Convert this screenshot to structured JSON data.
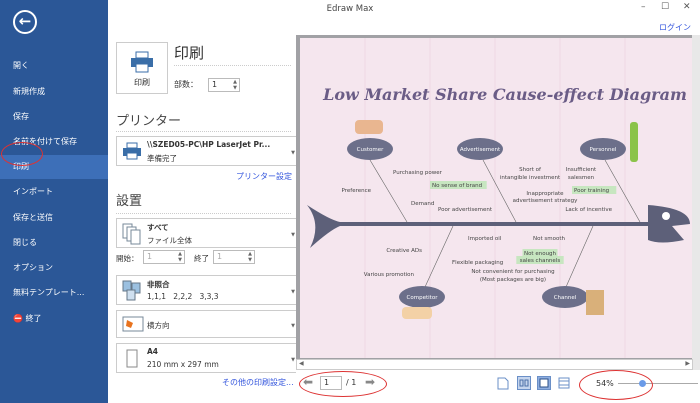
{
  "window": {
    "title": "Edraw Max",
    "login": "ログイン"
  },
  "sidebar": {
    "items": [
      {
        "label": "開く"
      },
      {
        "label": "新規作成"
      },
      {
        "label": "保存"
      },
      {
        "label": "名前を付けて保存"
      },
      {
        "label": "印刷"
      },
      {
        "label": "インポート"
      },
      {
        "label": "保存と送信"
      },
      {
        "label": "閉じる"
      },
      {
        "label": "オプション"
      },
      {
        "label": "無料テンプレート..."
      },
      {
        "label": "終了"
      }
    ],
    "active": "印刷"
  },
  "print": {
    "heading": "印刷",
    "button_label": "印刷",
    "copies_label": "部数：",
    "copies_value": "1"
  },
  "printer": {
    "heading": "プリンター",
    "name": "\\\\SZED05-PC\\HP LaserJet Pr...",
    "status": "準備完了",
    "settings_link": "プリンター設定"
  },
  "settings": {
    "heading": "設置",
    "range_title": "すべて",
    "range_sub": "ファイル全体",
    "start_label": "開始：",
    "start_value": "1",
    "end_label": "終了",
    "end_value": "1",
    "collate_title": "非照合",
    "collate_sub": "1,1,1   2,2,2   3,3,3",
    "orientation": "横方向",
    "paper_title": "A4",
    "paper_sub": "210 mm x 297 mm",
    "more_link": "その他の印刷設定..."
  },
  "diagram": {
    "title": "Low Market Share Cause-effect Diagram",
    "categories": [
      "Customer",
      "Advertisement",
      "Personnel",
      "Competitor",
      "Channel"
    ],
    "causes": [
      "Purchasing power",
      "Preference",
      "Demand",
      "No sense of brand",
      "Short of",
      "intangible investment",
      "Inappropriate",
      "advertisement strategy",
      "Poor advertisement",
      "Insufficient",
      "salesmen",
      "Poor training",
      "Lack of incentive",
      "Imported oil",
      "Creative ADs",
      "Flexible packaging",
      "Various promotion",
      "Not smooth",
      "Not enough",
      "sales channels",
      "Not convenient for purchasing",
      "(Most packages are big)"
    ]
  },
  "footer": {
    "page_value": "1",
    "page_total": "/ 1",
    "zoom": "54%",
    "zoom_fraction": 0.3
  },
  "colors": {
    "sidebar": "#2b5797",
    "accent": "#3355dd",
    "bone": "#5d6079",
    "highlight": "#c7e6c0"
  }
}
